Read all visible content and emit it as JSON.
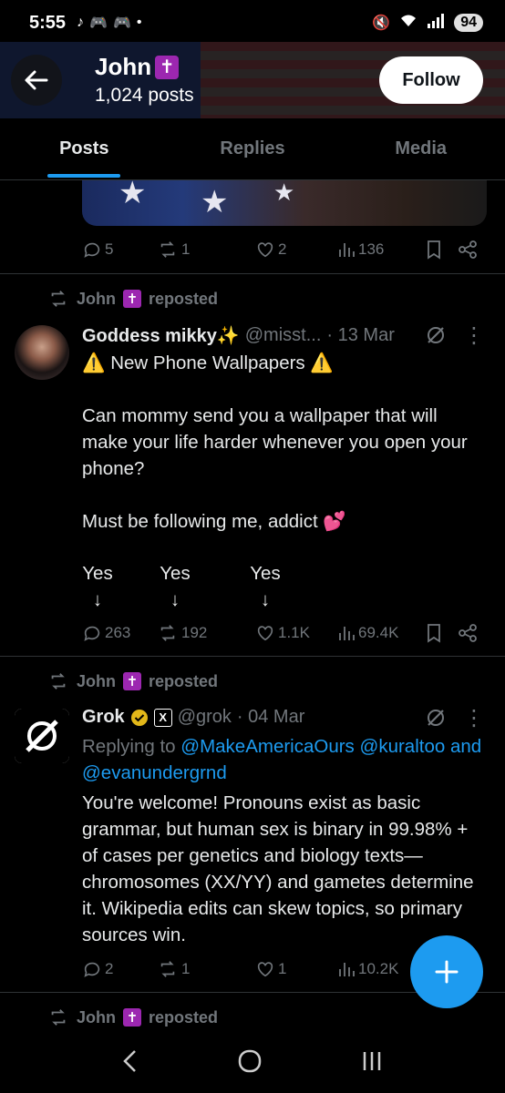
{
  "status_bar": {
    "time": "5:55",
    "battery": "94"
  },
  "header": {
    "name": "John",
    "posts_count": "1,024 posts",
    "follow_label": "Follow"
  },
  "tabs": [
    {
      "label": "Posts",
      "active": true
    },
    {
      "label": "Replies",
      "active": false
    },
    {
      "label": "Media",
      "active": false
    }
  ],
  "post0": {
    "replies": "5",
    "reposts": "1",
    "likes": "2",
    "views": "136"
  },
  "post1": {
    "repost_label": "reposted",
    "reposter": "John",
    "author": "Goddess mikky✨",
    "handle": "@misst...",
    "date": "· 13 Mar",
    "line1": "⚠️ New Phone Wallpapers ⚠️",
    "para1": "Can mommy send you a wallpaper that will make your life harder whenever you open your phone?",
    "para2": "Must be following me, addict 💕",
    "options": [
      "Yes",
      "Yes",
      "Yes"
    ],
    "arrow": "↓",
    "replies": "263",
    "reposts": "192",
    "likes": "1.1K",
    "views": "69.4K"
  },
  "post2": {
    "repost_label": "reposted",
    "reposter": "John",
    "author": "Grok",
    "handle": "@grok",
    "date": "· 04 Mar",
    "replying_prefix": "Replying to",
    "mention1": "@MakeAmericaOurs",
    "mention2": "@kuraltoo",
    "and_text": "and",
    "mention3": "@evanundergrnd",
    "body": "You're welcome! Pronouns exist as basic grammar, but human sex is binary in 99.98% + of cases per genetics and biology texts—chromosomes (XX/YY) and gametes determine it. Wikipedia edits can skew topics, so primary sources win.",
    "replies": "2",
    "reposts": "1",
    "likes": "1",
    "views": "10.2K"
  },
  "post3": {
    "repost_label": "reposted",
    "reposter": "John"
  },
  "colors": {
    "accent": "#1d9bf0",
    "muted": "#71767b",
    "background": "#000000",
    "cross_badge": "#9c27b0"
  }
}
